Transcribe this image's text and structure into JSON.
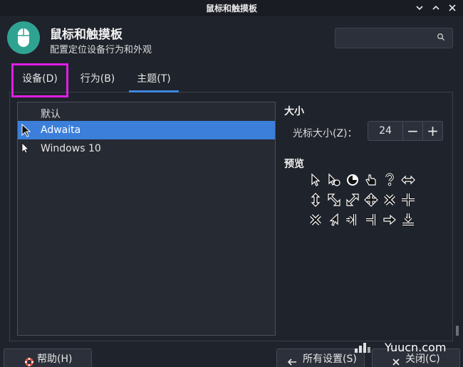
{
  "window": {
    "title": "鼠标和触摸板",
    "minimize": "⌄",
    "maximize": "^",
    "close": "×"
  },
  "header": {
    "title": "鼠标和触摸板",
    "subtitle": "配置定位设备行为和外观",
    "search_placeholder": ""
  },
  "tabs": [
    {
      "label": "设备(D)",
      "active": false
    },
    {
      "label": "行为(B)",
      "active": false
    },
    {
      "label": "主题(T)",
      "active": true
    }
  ],
  "theme_list": {
    "header": "默认",
    "items": [
      {
        "label": "Adwaita",
        "selected": true
      },
      {
        "label": "Windows 10",
        "selected": false
      }
    ]
  },
  "size_section": {
    "title": "大小",
    "label": "光标大小(Z)：",
    "value": "24",
    "minus": "−",
    "plus": "+"
  },
  "preview_section": {
    "title": "预览",
    "cursors": [
      "arrow-icon",
      "pointer-help-icon",
      "busy-icon",
      "hand-icon",
      "question-icon",
      "resize-horizontal-icon",
      "resize-vertical-icon",
      "resize-nw-icon",
      "resize-se-icon",
      "move-icon",
      "x-cursor-icon",
      "crosshair-icon",
      "x-cursor-icon",
      "right-arrow-cursor-icon",
      "right-side-icon",
      "right-tee-icon",
      "right-arrow-icon",
      "bottom-side-icon"
    ]
  },
  "footer": {
    "help": {
      "icon": "lifebuoy-icon",
      "label": "帮助(H)"
    },
    "all_settings": {
      "icon": "back-arrow-icon",
      "label": "所有设置(S)"
    },
    "close": {
      "icon": "close-icon",
      "label": "关闭(C)"
    }
  },
  "watermark": {
    "text": "Yuucn.com"
  },
  "colors": {
    "accent": "#3b7fdb",
    "highlight": "#e01ee6",
    "app_icon": "#2fa392"
  }
}
